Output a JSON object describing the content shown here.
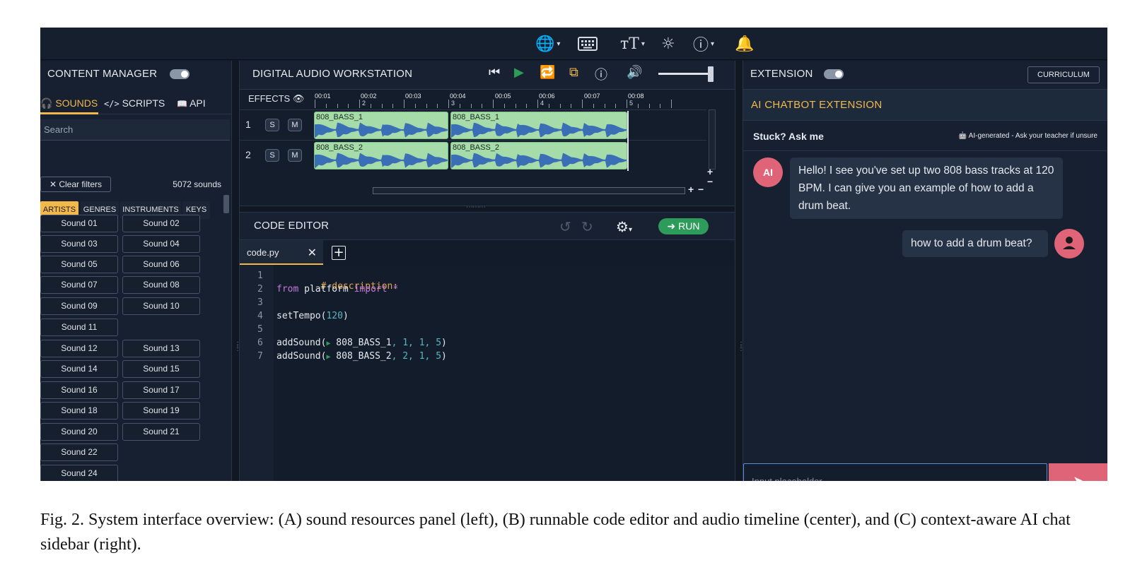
{
  "topbar": {
    "icons": [
      "globe-icon",
      "keyboard-icon",
      "font-size-icon",
      "brightness-icon",
      "info-icon",
      "bell-icon"
    ]
  },
  "content_manager": {
    "title": "CONTENT MANAGER",
    "tabs": [
      {
        "label": "SOUNDS",
        "icon": "headphones-icon",
        "active": true
      },
      {
        "label": "SCRIPTS",
        "icon": "code-icon",
        "active": false
      },
      {
        "label": "API",
        "icon": "book-icon",
        "active": false
      }
    ],
    "search_placeholder": "Search",
    "clear_filters": "✕ Clear filters",
    "sound_count": "5072 sounds",
    "filter_tabs": [
      "ARTISTS",
      "GENRES",
      "INSTRUMENTS",
      "KEYS"
    ],
    "active_filter": "ARTISTS",
    "sounds": {
      "s01": "Sound 01",
      "s02": "Sound 02",
      "s03": "Sound 03",
      "s04": "Sound 04",
      "s05": "Sound 05",
      "s06": "Sound 06",
      "s07": "Sound 07",
      "s08": "Sound 08",
      "s09": "Sound 09",
      "s10": "Sound 10",
      "s11": "Sound 11",
      "s12": "Sound 12",
      "s13": "Sound 13",
      "s14": "Sound 14",
      "s15": "Sound 15",
      "s16": "Sound 16",
      "s17": "Sound 17",
      "s18": "Sound 18",
      "s19": "Sound 19",
      "s20": "Sound 20",
      "s21": "Sound 21",
      "s22": "Sound 22",
      "s24": "Sound 24"
    }
  },
  "daw": {
    "title": "DIGITAL AUDIO WORKSTATION",
    "effects_label": "EFFECTS",
    "ruler_times": [
      "00:01",
      "00:02",
      "00:03",
      "00:04",
      "00:05",
      "00:06",
      "00:07",
      "00:08"
    ],
    "measure_numbers": [
      "2",
      "3",
      "4",
      "5"
    ],
    "volume_level": 1.0,
    "tracks": [
      {
        "number": "1",
        "solo": "S",
        "mute": "M",
        "clips": [
          "808_BASS_1",
          "808_BASS_1"
        ]
      },
      {
        "number": "2",
        "solo": "S",
        "mute": "M",
        "clips": [
          "808_BASS_2",
          "808_BASS_2"
        ]
      }
    ]
  },
  "editor": {
    "title": "CODE EDITOR",
    "run_label": "RUN",
    "file_tab": "code.py",
    "line_numbers": [
      "1",
      "2",
      "3",
      "4",
      "5",
      "6",
      "7"
    ],
    "code": {
      "l1": "# description:",
      "l2_kw1": "from",
      "l2_mod": " platform ",
      "l2_kw2": "import",
      "l2_star": " *",
      "l4_fn": "setTempo(",
      "l4_num": "120",
      "l4_end": ")",
      "l6_fn": "addSound(",
      "l6_name": " 808_BASS_1",
      "l6_args": ", 1, 1, 5",
      "l6_end": ")",
      "l7_fn": "addSound(",
      "l7_name": " 808_BASS_2",
      "l7_args": ", 2, 1, 5",
      "l7_end": ")"
    }
  },
  "extension": {
    "title": "EXTENSION",
    "curriculum_label": "CURRICULUM",
    "chatbot_title": "AI CHATBOT EXTENSION",
    "ask_title": "Stuck? Ask me",
    "ask_note": "🤖 AI-generated - Ask your teacher if unsure",
    "ai_avatar": "AI",
    "messages": {
      "ai_message": "Hello! I see you've set up two 808 bass tracks at 120 BPM. I can give you an example of how to add a drum beat.",
      "user_message": "how to add a drum beat?"
    },
    "input_placeholder": "Input placeholder"
  },
  "caption": "Fig. 2.  System interface overview: (A) sound resources panel (left), (B) runnable code editor and audio timeline (center), and (C) context-aware AI chat sidebar (right).",
  "colors": {
    "background": "#111a28",
    "accent": "#f2b84b",
    "clip": "#a6dcaa",
    "run": "#2d9b5a",
    "avatar": "#e06477"
  }
}
